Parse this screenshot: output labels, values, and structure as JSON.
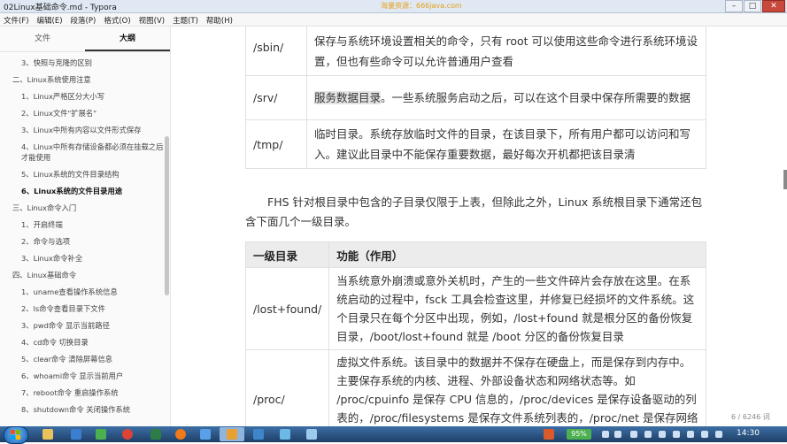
{
  "window": {
    "title": "02Linux基础命令.md - Typora",
    "watermark": "海量资源：666java.com",
    "btn_min": "–",
    "btn_max": "□",
    "btn_close": "✕"
  },
  "menubar": [
    "文件(F)",
    "编辑(E)",
    "段落(P)",
    "格式(O)",
    "视图(V)",
    "主题(T)",
    "帮助(H)"
  ],
  "sidebar": {
    "tabs": [
      "文件",
      "大纲"
    ],
    "active_tab": "大纲",
    "outline": [
      "3、快照与克隆的区别",
      "二、Linux系统使用注意",
      "1、Linux严格区分大小写",
      "2、Linux文件\"扩展名\"",
      "3、Linux中所有内容以文件形式保存",
      "4、Linux中所有存储设备都必须在挂载之后才能使用",
      "5、Linux系统的文件目录结构",
      "6、Linux系统的文件目录用途",
      "三、Linux命令入门",
      "1、开启终端",
      "2、命令与选项",
      "3、Linux命令补全",
      "四、Linux基础命令",
      "1、uname查看操作系统信息",
      "2、ls命令查看目录下文件",
      "3、pwd命令 显示当前路径",
      "4、cd命令 切换目录",
      "5、clear命令 清除屏幕信息",
      "6、whoami命令 显示当前用户",
      "7、reboot命令 重启操作系统",
      "8、shutdown命令 关闭操作系统"
    ],
    "back_icon_text": "<",
    "code_icon_text": "</>"
  },
  "table1": {
    "rows": [
      {
        "dir": "/sbin/",
        "desc": "保存与系统环境设置相关的命令，只有 root 可以使用这些命令进行系统环境设置，但也有些命令可以允许普通用户查看"
      },
      {
        "dir": "/srv/",
        "desc_highlight": "服务数据目录",
        "desc": "。一些系统服务启动之后，可以在这个目录中保存所需要的数据"
      },
      {
        "dir": "/tmp/",
        "desc": "临时目录。系统存放临时文件的目录，在该目录下，所有用户都可以访问和写入。建议此目录中不能保存重要数据，最好每次开机都把该目录清"
      }
    ]
  },
  "paragraph": "FHS 针对根目录中包含的子目录仅限于上表，但除此之外，Linux 系统根目录下通常还包含下面几个一级目录。",
  "table2": {
    "headers": [
      "一级目录",
      "功能（作用）"
    ],
    "rows": [
      {
        "dir": "/lost+found/",
        "desc": "当系统意外崩溃或意外关机时，产生的一些文件碎片会存放在这里。在系统启动的过程中，fsck 工具会检查这里，并修复已经损坏的文件系统。这个目录只在每个分区中出现，例如，/lost+found 就是根分区的备份恢复目录，/boot/lost+found 就是 /boot 分区的备份恢复目录"
      },
      {
        "dir": "/proc/",
        "desc": "虚拟文件系统。该目录中的数据并不保存在硬盘上，而是保存到内存中。主要保存系统的内核、进程、外部设备状态和网络状态等。如 /proc/cpuinfo 是保存 CPU 信息的，/proc/devices 是保存设备驱动的列表的，/proc/filesystems 是保存文件系统列表的，/proc/net 是保存网络协议"
      }
    ]
  },
  "status": {
    "word_count": "6 / 6246 词"
  },
  "taskbar": {
    "battery": "95%",
    "time": "14:30"
  },
  "colors": {
    "titlebar": "#dfe8f3",
    "taskbar": "#1e3f66",
    "highlight": "#e4e4e4"
  }
}
